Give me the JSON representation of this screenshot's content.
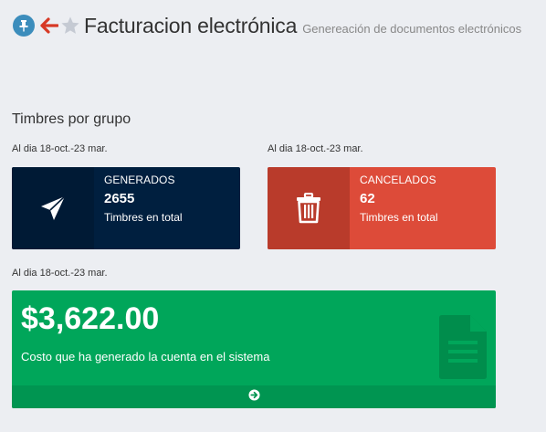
{
  "header": {
    "title": "Facturacion electrónica",
    "subtitle": "Genereación de documentos electrónicos",
    "icons": [
      "pin-icon",
      "arrow-left-icon",
      "star-icon"
    ]
  },
  "section": {
    "title": "Timbres por grupo"
  },
  "generados": {
    "date": "Al dia 18-oct.-23 mar.",
    "label": "GENERADOS",
    "number": "2655",
    "text": "Timbres en total",
    "icon": "paper-plane-icon",
    "color": "#001f3f"
  },
  "cancelados": {
    "date": "Al dia 18-oct.-23 mar.",
    "label": "CANCELADOS",
    "number": "62",
    "text": "Timbres en total",
    "icon": "trash-icon",
    "color": "#dd4b39"
  },
  "costo": {
    "date": "Al dia 18-oct.-23 mar.",
    "amount": "$3,622.00",
    "text": "Costo que ha generado la cuenta en el sistema",
    "icon": "document-icon",
    "footer_icon": "arrow-circle-right-icon",
    "color": "#00a65a"
  }
}
